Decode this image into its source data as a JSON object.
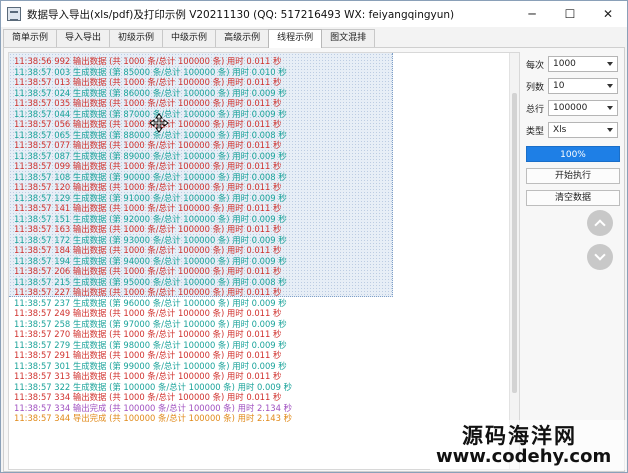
{
  "window": {
    "title": "数据导入导出(xls/pdf)及打印示例 V20211130 (QQ: 517216493 WX: feiyangqingyun)",
    "minimize_glyph": "─",
    "maximize_glyph": "☐",
    "close_glyph": "✕"
  },
  "tabs": [
    {
      "label": "简单示例",
      "active": false
    },
    {
      "label": "导入导出",
      "active": false
    },
    {
      "label": "初级示例",
      "active": false
    },
    {
      "label": "中级示例",
      "active": false
    },
    {
      "label": "高级示例",
      "active": false
    },
    {
      "label": "线程示例",
      "active": true
    },
    {
      "label": "图文混排",
      "active": false
    }
  ],
  "log": [
    {
      "text": "11:38:56 992 输出数据 (共 1000 条/总计 100000 条) 用时 0.011 秒",
      "color": "red"
    },
    {
      "text": "11:38:57 003 生成数据 (第 85000 条/总计 100000 条) 用时 0.010 秒",
      "color": "teal"
    },
    {
      "text": "11:38:57 013 输出数据 (共 1000 条/总计 100000 条) 用时 0.011 秒",
      "color": "red"
    },
    {
      "text": "11:38:57 024 生成数据 (第 86000 条/总计 100000 条) 用时 0.009 秒",
      "color": "teal"
    },
    {
      "text": "11:38:57 035 输出数据 (共 1000 条/总计 100000 条) 用时 0.011 秒",
      "color": "red"
    },
    {
      "text": "11:38:57 044 生成数据 (第 87000 条/总计 100000 条) 用时 0.009 秒",
      "color": "teal"
    },
    {
      "text": "11:38:57 056 输出数据 (共 1000 条/总计 100000 条) 用时 0.011 秒",
      "color": "red"
    },
    {
      "text": "11:38:57 065 生成数据 (第 88000 条/总计 100000 条) 用时 0.008 秒",
      "color": "teal"
    },
    {
      "text": "11:38:57 077 输出数据 (共 1000 条/总计 100000 条) 用时 0.011 秒",
      "color": "red"
    },
    {
      "text": "11:38:57 087 生成数据 (第 89000 条/总计 100000 条) 用时 0.009 秒",
      "color": "teal"
    },
    {
      "text": "11:38:57 099 输出数据 (共 1000 条/总计 100000 条) 用时 0.011 秒",
      "color": "red"
    },
    {
      "text": "11:38:57 108 生成数据 (第 90000 条/总计 100000 条) 用时 0.008 秒",
      "color": "teal"
    },
    {
      "text": "11:38:57 120 输出数据 (共 1000 条/总计 100000 条) 用时 0.011 秒",
      "color": "red"
    },
    {
      "text": "11:38:57 129 生成数据 (第 91000 条/总计 100000 条) 用时 0.009 秒",
      "color": "teal"
    },
    {
      "text": "11:38:57 141 输出数据 (共 1000 条/总计 100000 条) 用时 0.011 秒",
      "color": "red"
    },
    {
      "text": "11:38:57 151 生成数据 (第 92000 条/总计 100000 条) 用时 0.009 秒",
      "color": "teal"
    },
    {
      "text": "11:38:57 163 输出数据 (共 1000 条/总计 100000 条) 用时 0.011 秒",
      "color": "red"
    },
    {
      "text": "11:38:57 172 生成数据 (第 93000 条/总计 100000 条) 用时 0.009 秒",
      "color": "teal"
    },
    {
      "text": "11:38:57 184 输出数据 (共 1000 条/总计 100000 条) 用时 0.011 秒",
      "color": "red"
    },
    {
      "text": "11:38:57 194 生成数据 (第 94000 条/总计 100000 条) 用时 0.009 秒",
      "color": "teal"
    },
    {
      "text": "11:38:57 206 输出数据 (共 1000 条/总计 100000 条) 用时 0.011 秒",
      "color": "red"
    },
    {
      "text": "11:38:57 215 生成数据 (第 95000 条/总计 100000 条) 用时 0.008 秒",
      "color": "teal"
    },
    {
      "text": "11:38:57 227 输出数据 (共 1000 条/总计 100000 条) 用时 0.011 秒",
      "color": "red"
    },
    {
      "text": "11:38:57 237 生成数据 (第 96000 条/总计 100000 条) 用时 0.009 秒",
      "color": "teal"
    },
    {
      "text": "11:38:57 249 输出数据 (共 1000 条/总计 100000 条) 用时 0.011 秒",
      "color": "red"
    },
    {
      "text": "11:38:57 258 生成数据 (第 97000 条/总计 100000 条) 用时 0.009 秒",
      "color": "teal"
    },
    {
      "text": "11:38:57 270 输出数据 (共 1000 条/总计 100000 条) 用时 0.011 秒",
      "color": "red"
    },
    {
      "text": "11:38:57 279 生成数据 (第 98000 条/总计 100000 条) 用时 0.009 秒",
      "color": "teal"
    },
    {
      "text": "11:38:57 291 输出数据 (共 1000 条/总计 100000 条) 用时 0.011 秒",
      "color": "red"
    },
    {
      "text": "11:38:57 301 生成数据 (第 99000 条/总计 100000 条) 用时 0.009 秒",
      "color": "teal"
    },
    {
      "text": "11:38:57 313 输出数据 (共 1000 条/总计 100000 条) 用时 0.011 秒",
      "color": "red"
    },
    {
      "text": "11:38:57 322 生成数据 (第 100000 条/总计 100000 条) 用时 0.009 秒",
      "color": "teal"
    },
    {
      "text": "11:38:57 334 输出数据 (共 1000 条/总计 100000 条) 用时 0.011 秒",
      "color": "red"
    },
    {
      "text": "11:38:57 334 输出完成 (共 100000 条/总计 100000 条) 用时 2.134 秒",
      "color": "purple"
    },
    {
      "text": "11:38:57 344 导出完成 (共 100000 条/总计 100000 条) 用时 2.143 秒",
      "color": "orange"
    }
  ],
  "panel": {
    "fields": [
      {
        "label": "每次",
        "value": "1000"
      },
      {
        "label": "列数",
        "value": "10"
      },
      {
        "label": "总行",
        "value": "100000"
      },
      {
        "label": "类型",
        "value": "Xls"
      }
    ],
    "progress": {
      "value": 100,
      "label": "100%"
    },
    "start_label": "开始执行",
    "clear_label": "清空数据",
    "up_icon": "chevron-up-icon",
    "down_icon": "chevron-down-icon"
  },
  "watermark": {
    "name": "源码海洋网",
    "url": "www.codehy.com"
  },
  "colors": {
    "red": "#d0312d",
    "teal": "#1aa39a",
    "purple": "#a050c0",
    "orange": "#e08a1a",
    "progress": "#1e7fe6"
  }
}
